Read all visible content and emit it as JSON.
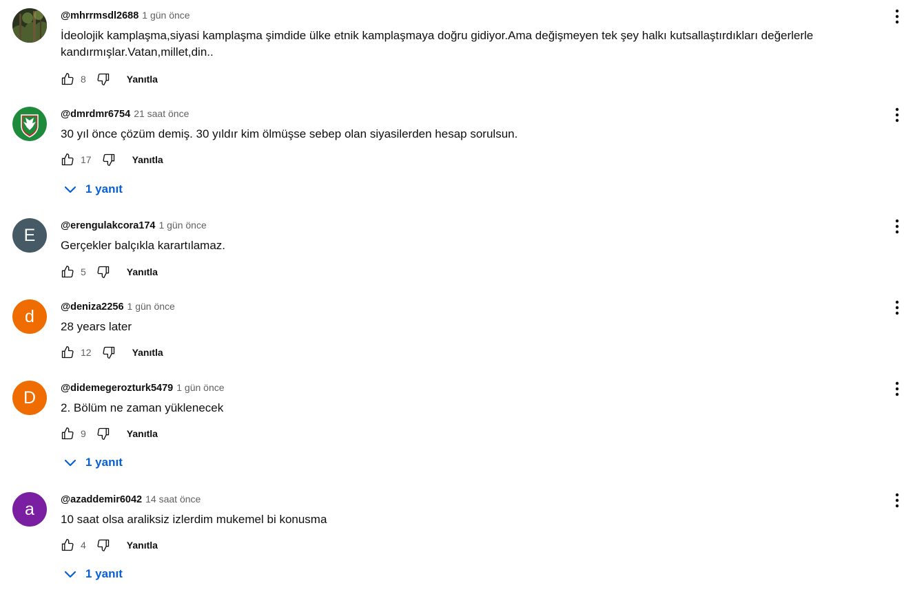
{
  "colors": {
    "link_blue": "#065fd4",
    "meta_gray": "#606060",
    "text_dark": "#0f0f0f"
  },
  "icons": {
    "like": "thumbs-up-outline-icon",
    "dislike": "thumbs-down-outline-icon",
    "menu": "vertical-ellipsis-icon",
    "expand": "chevron-down-icon"
  },
  "comments": [
    {
      "author": "@mhrrmsdl2688",
      "time": "1 gün önce",
      "text": "İdeolojik kamplaşma,siyasi kamplaşma şimdide ülke etnik kamplaşmaya doğru gidiyor.Ama değişmeyen tek şey halkı kutsallaştırdıkları değerlerle kandırmışlar.Vatan,millet,din..",
      "likes": "8",
      "reply_label": "Yanıtla",
      "avatar_letter": "",
      "avatar_color": "#3d4a2a"
    },
    {
      "author": "@dmrdmr6754",
      "time": "21 saat önce",
      "text": "30 yıl önce çözüm demiş. 30 yıldır kim ölmüşse sebep olan siyasilerden hesap sorulsun.",
      "likes": "17",
      "reply_label": "Yanıtla",
      "avatar_letter": "",
      "avatar_color": "#1e8a3c",
      "replies_label": "1 yanıt"
    },
    {
      "author": "@erengulakcora174",
      "time": "1 gün önce",
      "text": "Gerçekler balçıkla karartılamaz.",
      "likes": "5",
      "reply_label": "Yanıtla",
      "avatar_letter": "E",
      "avatar_color": "#455a64"
    },
    {
      "author": "@deniza2256",
      "time": "1 gün önce",
      "text": "28 years later",
      "likes": "12",
      "reply_label": "Yanıtla",
      "avatar_letter": "d",
      "avatar_color": "#ef6c00"
    },
    {
      "author": "@didemegerozturk5479",
      "time": "1 gün önce",
      "text": "2. Bölüm ne zaman yüklenecek",
      "likes": "9",
      "reply_label": "Yanıtla",
      "avatar_letter": "D",
      "avatar_color": "#ef6c00",
      "replies_label": "1 yanıt"
    },
    {
      "author": "@azaddemir6042",
      "time": "14 saat önce",
      "text": "10 saat olsa araliksiz izlerdim mukemel bi konusma",
      "likes": "4",
      "reply_label": "Yanıtla",
      "avatar_letter": "a",
      "avatar_color": "#7b1fa2",
      "replies_label": "1 yanıt"
    }
  ]
}
